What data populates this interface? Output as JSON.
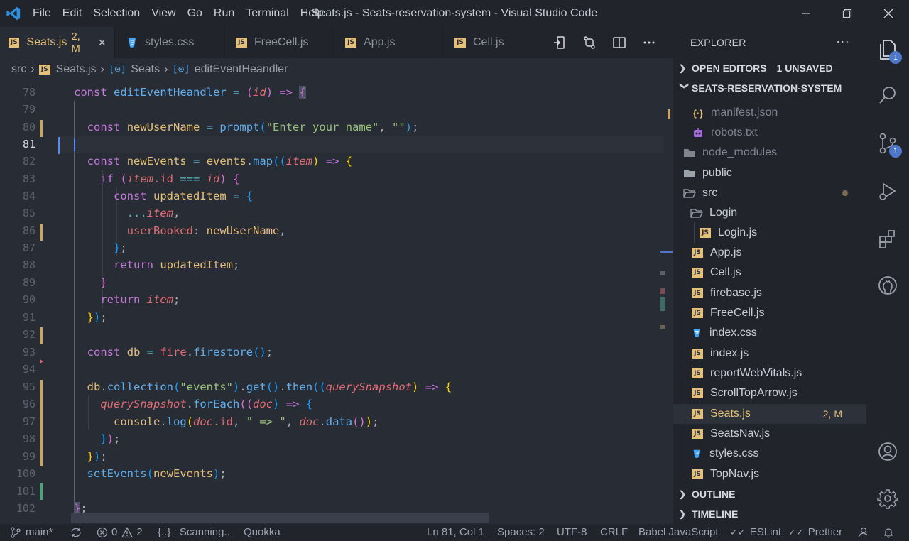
{
  "window": {
    "title": "Seats.js - Seats-reservation-system - Visual Studio Code",
    "menu": [
      "File",
      "Edit",
      "Selection",
      "View",
      "Go",
      "Run",
      "Terminal",
      "Help"
    ]
  },
  "tabs": [
    {
      "label": "Seats.js",
      "status": "2, M",
      "type": "js",
      "active": true
    },
    {
      "label": "styles.css",
      "type": "css"
    },
    {
      "label": "FreeCell.js",
      "type": "js"
    },
    {
      "label": "App.js",
      "type": "js"
    },
    {
      "label": "Cell.js",
      "type": "js"
    }
  ],
  "breadcrumb": {
    "folder": "src",
    "file": "Seats.js",
    "symbol1": "Seats",
    "symbol2": "editEventHeandler"
  },
  "editor": {
    "line_numbers": [
      "78",
      "79",
      "80",
      "81",
      "82",
      "83",
      "84",
      "85",
      "86",
      "87",
      "88",
      "89",
      "90",
      "91",
      "92",
      "93",
      "94",
      "95",
      "96",
      "97",
      "98",
      "99",
      "100",
      "101",
      "102"
    ],
    "current_line": "81"
  },
  "code": {
    "l78": {
      "kw": "const",
      "name": "editEventHeandler",
      "eq": "=",
      "p1": "(",
      "param": "id",
      "p2": ")",
      "arrow": "=>",
      "brace": "{"
    },
    "l80": {
      "kw": "const",
      "name": "newUserName",
      "eq": "=",
      "fn": "prompt",
      "p1": "(",
      "str1": "\"Enter your name\"",
      "comma": ",",
      "str2": "\"\"",
      "p2": ")",
      "semi": ";"
    },
    "l82": {
      "kw": "const",
      "name": "newEvents",
      "eq": "=",
      "obj": "events",
      "dot": ".",
      "fn": "map",
      "p1": "((",
      "param": "item",
      "p2": ")",
      "arrow": "=>",
      "brace": "{"
    },
    "l83": {
      "kw": "if",
      "p1": "(",
      "obj": "item",
      "prop": ".id",
      "op": "===",
      "id": "id",
      "p2": ")",
      "brace": "{"
    },
    "l84": {
      "kw": "const",
      "name": "updatedItem",
      "eq": "=",
      "brace": "{"
    },
    "l85": {
      "spread": "...",
      "obj": "item",
      "comma": ","
    },
    "l86": {
      "key": "userBooked",
      "colon": ":",
      "val": "newUserName",
      "comma": ","
    },
    "l87": {
      "brace": "}",
      "semi": ";"
    },
    "l88": {
      "kw": "return",
      "val": "updatedItem",
      "semi": ";"
    },
    "l89": {
      "brace": "}"
    },
    "l90": {
      "kw": "return",
      "val": "item",
      "semi": ";"
    },
    "l91": {
      "brace": "}",
      "paren": ")",
      "semi": ";"
    },
    "l93": {
      "kw": "const",
      "name": "db",
      "eq": "=",
      "obj": "fire",
      "dot": ".",
      "fn": "firestore",
      "paren": "()",
      "semi": ";"
    },
    "l95": {
      "obj": "db",
      "dot1": ".",
      "fn1": "collection",
      "p1": "(",
      "str": "\"events\"",
      "p2": ")",
      "dot2": ".",
      "fn2": "get",
      "p3": "()",
      "dot3": ".",
      "fn3": "then",
      "p4": "((",
      "param": "querySnapshot",
      "p5": ")",
      "arrow": "=>",
      "brace": "{"
    },
    "l96": {
      "obj": "querySnapshot",
      "dot": ".",
      "fn": "forEach",
      "p1": "((",
      "param": "doc",
      "p2": ")",
      "arrow": "=>",
      "brace": "{"
    },
    "l97": {
      "obj": "console",
      "dot1": ".",
      "fn": "log",
      "p1": "(",
      "a1": "doc",
      "prop": ".id",
      "comma1": ",",
      "str": "\" => \"",
      "comma2": ",",
      "a2": "doc",
      "dot2": ".",
      "fn2": "data",
      "p2": "()",
      "p3": ")",
      "semi": ";"
    },
    "l98": {
      "brace": "}",
      "paren": ")",
      "semi": ";"
    },
    "l99": {
      "brace": "}",
      "paren": ")",
      "semi": ";"
    },
    "l100": {
      "fn": "setEvents",
      "p1": "(",
      "arg": "newEvents",
      "p2": ")",
      "semi": ";"
    },
    "l102": {
      "brace": "}",
      "semi": ";"
    }
  },
  "explorer": {
    "title": "EXPLORER",
    "open_editors": {
      "label": "OPEN EDITORS",
      "badge": "1 UNSAVED"
    },
    "project": "SEATS-RESERVATION-SYSTEM",
    "items": [
      {
        "label": "manifest.json",
        "icon": "json-icon",
        "dim": true
      },
      {
        "label": "robots.txt",
        "icon": "robot-icon",
        "dim": true
      },
      {
        "label": "node_modules",
        "icon": "folder-icon",
        "dim": true
      },
      {
        "label": "public",
        "icon": "folder-icon"
      },
      {
        "label": "src",
        "icon": "folder-open-icon"
      },
      {
        "label": "Login",
        "icon": "folder-open-icon"
      },
      {
        "label": "Login.js",
        "icon": "js-icon"
      },
      {
        "label": "App.js",
        "icon": "js-icon"
      },
      {
        "label": "Cell.js",
        "icon": "js-icon"
      },
      {
        "label": "firebase.js",
        "icon": "js-icon"
      },
      {
        "label": "FreeCell.js",
        "icon": "js-icon"
      },
      {
        "label": "index.css",
        "icon": "css-icon"
      },
      {
        "label": "index.js",
        "icon": "js-icon"
      },
      {
        "label": "reportWebVitals.js",
        "icon": "js-icon"
      },
      {
        "label": "ScrollTopArrow.js",
        "icon": "js-icon"
      },
      {
        "label": "Seats.js",
        "icon": "js-icon",
        "status": "2, M",
        "selected": true
      },
      {
        "label": "SeatsNav.js",
        "icon": "js-icon"
      },
      {
        "label": "styles.css",
        "icon": "css-icon"
      },
      {
        "label": "TopNav.js",
        "icon": "js-icon"
      }
    ],
    "outline": "OUTLINE",
    "timeline": "TIMELINE"
  },
  "activity": {
    "explorer_badge": "1",
    "scm_badge": "1"
  },
  "status": {
    "branch": "main*",
    "errors": "0",
    "warnings": "2",
    "scanning": "{..} : Scanning..",
    "quokka": "Quokka",
    "position": "Ln 81, Col 1",
    "spaces": "Spaces: 2",
    "encoding": "UTF-8",
    "eol": "CRLF",
    "language": "Babel JavaScript",
    "eslint": "ESLint",
    "prettier": "Prettier"
  },
  "colors": {
    "accent": "#e5c07b",
    "keyword": "#c678dd",
    "function": "#61afef",
    "string": "#98c379",
    "variable": "#e06c75",
    "badge": "#4d78cc"
  }
}
